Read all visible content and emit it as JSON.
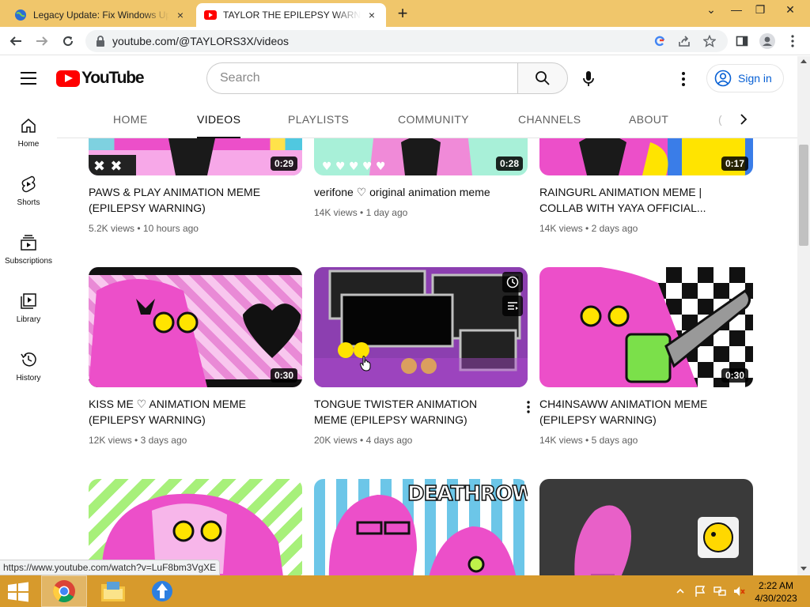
{
  "browser": {
    "tabs": [
      {
        "title": "Legacy Update: Fix Windows Update",
        "active": false
      },
      {
        "title": "TAYLOR THE EPILEPSY WARNING",
        "active": true
      }
    ],
    "url": "youtube.com/@TAYLORS3X/videos",
    "new_tab_symbol": "+",
    "tab_close_symbol": "×",
    "window_controls": {
      "minimize": "⌄",
      "restore": "—",
      "maximize": "❐",
      "close": "✕"
    }
  },
  "youtube": {
    "logo_text": "YouTube",
    "search_placeholder": "Search",
    "signin_label": "Sign in",
    "guide": [
      {
        "label": "Home",
        "icon": "home-icon"
      },
      {
        "label": "Shorts",
        "icon": "shorts-icon"
      },
      {
        "label": "Subscriptions",
        "icon": "subscriptions-icon"
      },
      {
        "label": "Library",
        "icon": "library-icon"
      },
      {
        "label": "History",
        "icon": "history-icon"
      }
    ],
    "channel_tabs": [
      "HOME",
      "VIDEOS",
      "PLAYLISTS",
      "COMMUNITY",
      "CHANNELS",
      "ABOUT"
    ],
    "active_tab": "VIDEOS",
    "videos": [
      {
        "title": "PAWS & PLAY ANIMATION MEME (EPILEPSY WARNING)",
        "views": "5.2K views",
        "age": "10 hours ago",
        "duration": "0:29"
      },
      {
        "title": "verifone ♡ original animation meme",
        "views": "14K views",
        "age": "1 day ago",
        "duration": "0:28"
      },
      {
        "title": "RAINGURL ANIMATION MEME | COLLAB WITH YAYA OFFICIAL...",
        "views": "14K views",
        "age": "2 days ago",
        "duration": "0:17"
      },
      {
        "title": "KISS ME ♡ ANIMATION MEME (EPILEPSY WARNING)",
        "views": "12K views",
        "age": "3 days ago",
        "duration": "0:30"
      },
      {
        "title": "TONGUE TWISTER ANIMATION MEME (EPILEPSY WARNING)",
        "views": "20K views",
        "age": "4 days ago",
        "duration": ""
      },
      {
        "title": "CH4INSAWW ANIMATION MEME (EPILEPSY WARNING)",
        "views": "14K views",
        "age": "5 days ago",
        "duration": "0:30"
      },
      {
        "title": "",
        "views": "",
        "age": "",
        "duration": ""
      },
      {
        "title": "",
        "views": "",
        "age": "",
        "duration": ""
      },
      {
        "title": "",
        "views": "",
        "age": "",
        "duration": ""
      }
    ],
    "meta_separator": "•",
    "deathrow_text": "DEATHROW"
  },
  "status_link": "https://www.youtube.com/watch?v=LuF8bm3VgXE",
  "taskbar": {
    "time": "2:22 AM",
    "date": "4/30/2023"
  },
  "colors": {
    "tab_strip": "#f0c66b",
    "taskbar": "#d79a2c",
    "youtube_red": "#ff0000",
    "link_blue": "#065fd4",
    "thumb_pink": "#ec4fc9"
  }
}
